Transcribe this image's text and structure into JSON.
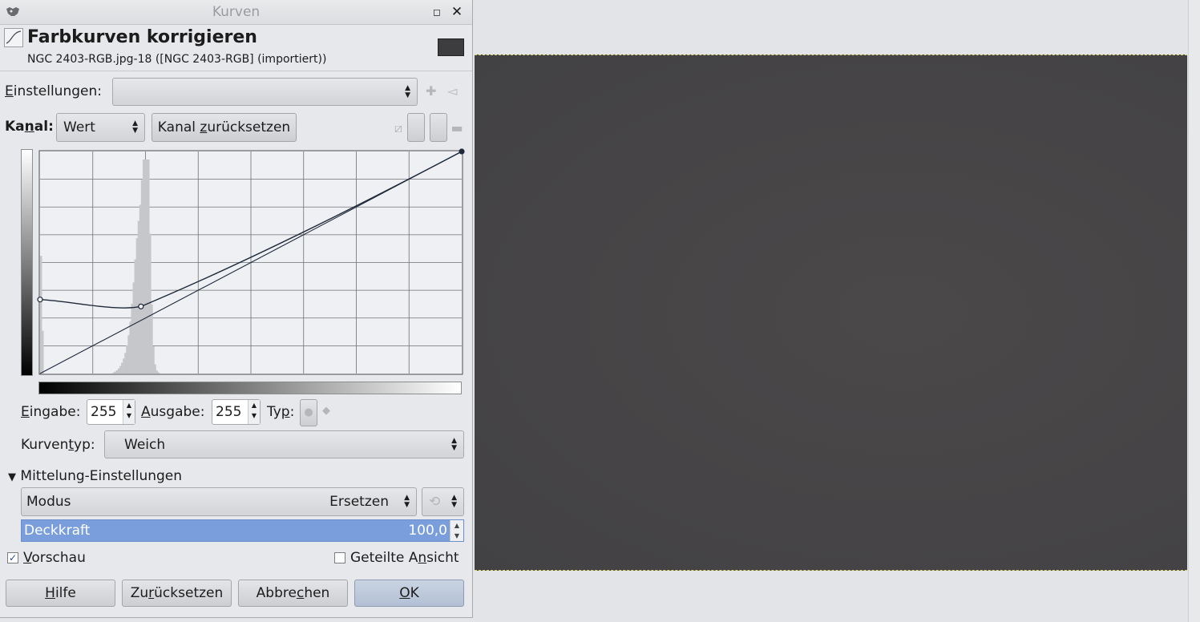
{
  "window": {
    "title": "Kurven"
  },
  "header": {
    "title": "Farbkurven korrigieren",
    "subtitle": "NGC 2403-RGB.jpg-18 ([NGC 2403-RGB] (importiert))"
  },
  "settings": {
    "label_pre": "",
    "label_ul": "E",
    "label_post": "instellungen:",
    "value": ""
  },
  "channel": {
    "label_pre": "Ka",
    "label_ul": "n",
    "label_post": "al:",
    "value": "Wert",
    "reset_pre": "Kanal ",
    "reset_ul": "z",
    "reset_post": "urücksetzen"
  },
  "io": {
    "input_ul": "E",
    "input_post": "ingabe:",
    "input_value": "255",
    "output_ul": "A",
    "output_post": "usgabe:",
    "output_value": "255",
    "type_pre": "Ty",
    "type_ul": "p",
    "type_post": ":"
  },
  "curve_type": {
    "label_pre": "Kurven",
    "label_ul": "t",
    "label_post": "yp:",
    "value": "Weich"
  },
  "blending": {
    "section_label": "Mittelung-Einstellungen",
    "mode_label": "Modus",
    "mode_value": "Ersetzen",
    "opacity_label": "Deckkraft",
    "opacity_value": "100,0"
  },
  "preview": {
    "ul": "V",
    "post": "orschau",
    "checked": true
  },
  "split_view": {
    "pre": "Geteilte A",
    "ul": "n",
    "post": "sicht",
    "checked": false
  },
  "buttons": {
    "help_ul": "H",
    "help_post": "ilfe",
    "reset_pre": "Zu",
    "reset_ul": "r",
    "reset_post": "ücksetzen",
    "cancel_pre": "Abbre",
    "cancel_ul": "c",
    "cancel_post": "hen",
    "ok_ul": "O",
    "ok_post": "K"
  },
  "curve": {
    "points": [
      [
        0,
        85
      ],
      [
        61,
        77
      ],
      [
        255,
        255
      ]
    ],
    "colors": {
      "line": "#1e2a3a",
      "grid": "#6e6f73",
      "bg": "#eef0f4",
      "histogram": "#c6c7ca"
    }
  }
}
